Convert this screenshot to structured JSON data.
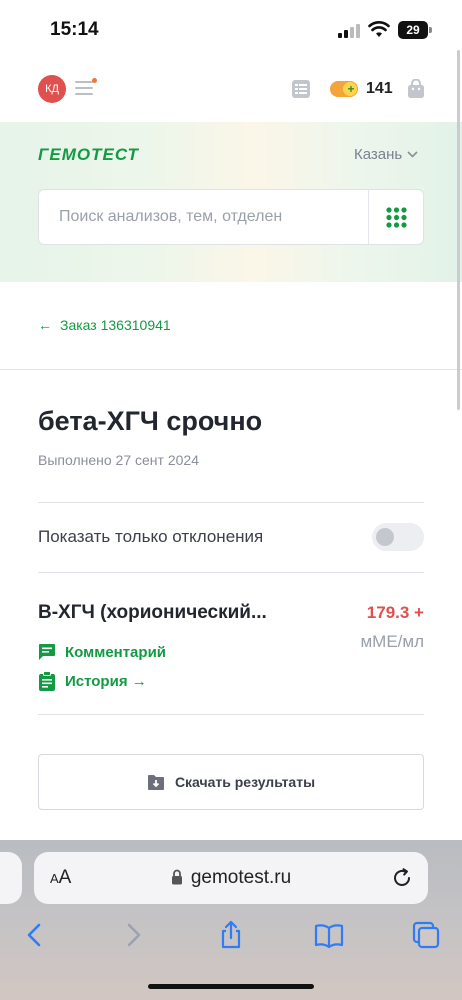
{
  "status_bar": {
    "time": "15:14",
    "battery": "29"
  },
  "header": {
    "avatar_initials": "КД",
    "bonus_count": "141",
    "accent_color": "#139a43",
    "alert_color": "#e0504f"
  },
  "hero": {
    "brand": "ГЕМОТЕСТ",
    "city": "Казань",
    "search_placeholder": "Поиск анализов, тем, отделен"
  },
  "breadcrumb": {
    "back_label": "Заказ 136310941"
  },
  "result": {
    "title": "бета-ХГЧ срочно",
    "date": "Выполнено 27 сент 2024",
    "filter_label": "Показать только отклонения",
    "filter_enabled": false,
    "tests": [
      {
        "name": "B-ХГЧ (хорионический...",
        "value": "179.3 +",
        "unit": "мМЕ/мл",
        "comment_label": "Комментарий",
        "history_label": "История →"
      }
    ],
    "download_label": "Скачать результаты"
  },
  "browser": {
    "aa_label_small": "A",
    "aa_label": "A",
    "url": "gemotest.ru"
  },
  "icons": [
    "signal-icon",
    "wifi-icon",
    "battery-icon",
    "menu-icon",
    "list-icon",
    "bag-icon",
    "chevron-down-icon",
    "grid-icon",
    "back-arrow-icon",
    "comment-icon",
    "clipboard-icon",
    "download-icon",
    "lock-icon",
    "reload-icon",
    "back-icon",
    "forward-icon",
    "share-icon",
    "bookmarks-icon",
    "tabs-icon"
  ]
}
